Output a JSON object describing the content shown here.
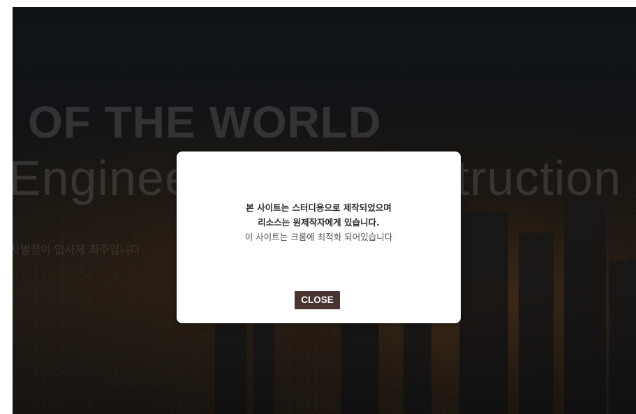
{
  "hero": {
    "line1": "OF THE WORLD",
    "line2": "Engineering & Construction",
    "subtitle": "차별점이 없사제 최주입니다"
  },
  "popup": {
    "line1": "본 사이트는 스터디용으로 제작되었으며",
    "line2": "리소스는 원제작자에게 있습니다.",
    "line3": "이 사이트는 크롬에 최적화 되어있습니다",
    "close_label": "CLOSE"
  },
  "colors": {
    "close_button_bg": "#4a3432",
    "modal_bg": "#ffffff",
    "overlay": "rgba(0,0,0,0.45)"
  }
}
